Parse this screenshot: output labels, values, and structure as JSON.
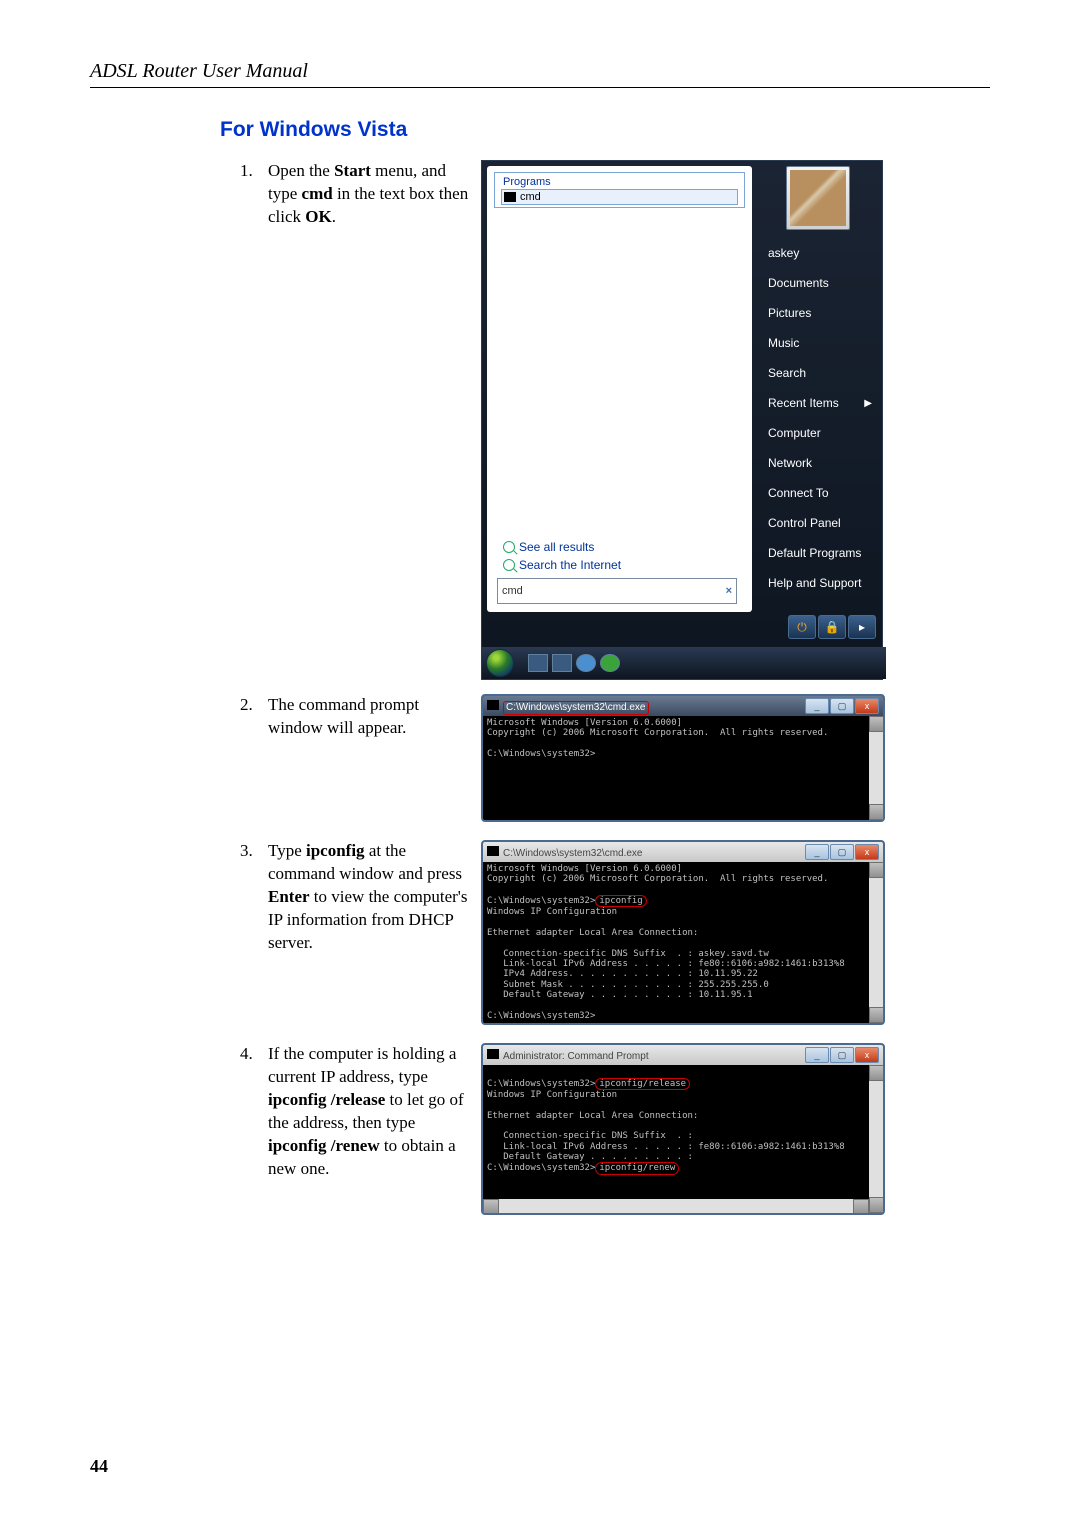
{
  "header": {
    "title": "ADSL Router User Manual"
  },
  "section": {
    "title": "For Windows Vista"
  },
  "steps": [
    {
      "num": "1.",
      "text_parts": [
        "Open the ",
        "Start",
        " menu, and type ",
        "cmd",
        " in the text box then click ",
        "OK",
        "."
      ]
    },
    {
      "num": "2.",
      "text": "The command prompt window will appear."
    },
    {
      "num": "3.",
      "text_parts": [
        "Type ",
        "ipconfig",
        " at the command window and press ",
        "Enter",
        " to view the computer's IP information from DHCP server."
      ]
    },
    {
      "num": "4.",
      "text_parts": [
        "If the computer is holding a current IP address, type ",
        "ipconfig /release",
        " to let go of the address, then type ",
        "ipconfig /renew",
        " to obtain a new one."
      ]
    }
  ],
  "vista": {
    "programs_label": "Programs",
    "cmd_result": "cmd",
    "see_all": "See all results",
    "search_internet": "Search the Internet",
    "search_value": "cmd",
    "right_items": [
      "askey",
      "Documents",
      "Pictures",
      "Music",
      "Search",
      "Recent Items",
      "Computer",
      "Network",
      "Connect To",
      "Control Panel",
      "Default Programs",
      "Help and Support"
    ]
  },
  "cmd1": {
    "title": "C:\\Windows\\system32\\cmd.exe",
    "lines": [
      "Microsoft Windows [Version 6.0.6000]",
      "Copyright (c) 2006 Microsoft Corporation.  All rights reserved.",
      "",
      "C:\\Windows\\system32>"
    ]
  },
  "cmd2": {
    "title": "C:\\Windows\\system32\\cmd.exe",
    "pre": "C:\\Windows\\system32>",
    "hl": "ipconfig",
    "lines_top": [
      "Microsoft Windows [Version 6.0.6000]",
      "Copyright (c) 2006 Microsoft Corporation.  All rights reserved.",
      ""
    ],
    "lines_bottom": [
      "",
      "Windows IP Configuration",
      "",
      "Ethernet adapter Local Area Connection:",
      "",
      "   Connection-specific DNS Suffix  . : askey.savd.tw",
      "   Link-local IPv6 Address . . . . . : fe80::6106:a982:1461:b313%8",
      "   IPv4 Address. . . . . . . . . . . : 10.11.95.22",
      "   Subnet Mask . . . . . . . . . . . : 255.255.255.0",
      "   Default Gateway . . . . . . . . . : 10.11.95.1",
      "",
      "C:\\Windows\\system32>"
    ]
  },
  "cmd3": {
    "title": "Administrator: Command Prompt",
    "pre1": "C:\\Windows\\system32>",
    "hl1": "ipconfig/release",
    "mid": [
      "",
      "Windows IP Configuration",
      "",
      "Ethernet adapter Local Area Connection:",
      "",
      "   Connection-specific DNS Suffix  . :",
      "   Link-local IPv6 Address . . . . . : fe80::6106:a982:1461:b313%8",
      "   Default Gateway . . . . . . . . . :",
      ""
    ],
    "pre2": "C:\\Windows\\system32>",
    "hl2": "ipconfig/renew"
  },
  "page_number": "44"
}
